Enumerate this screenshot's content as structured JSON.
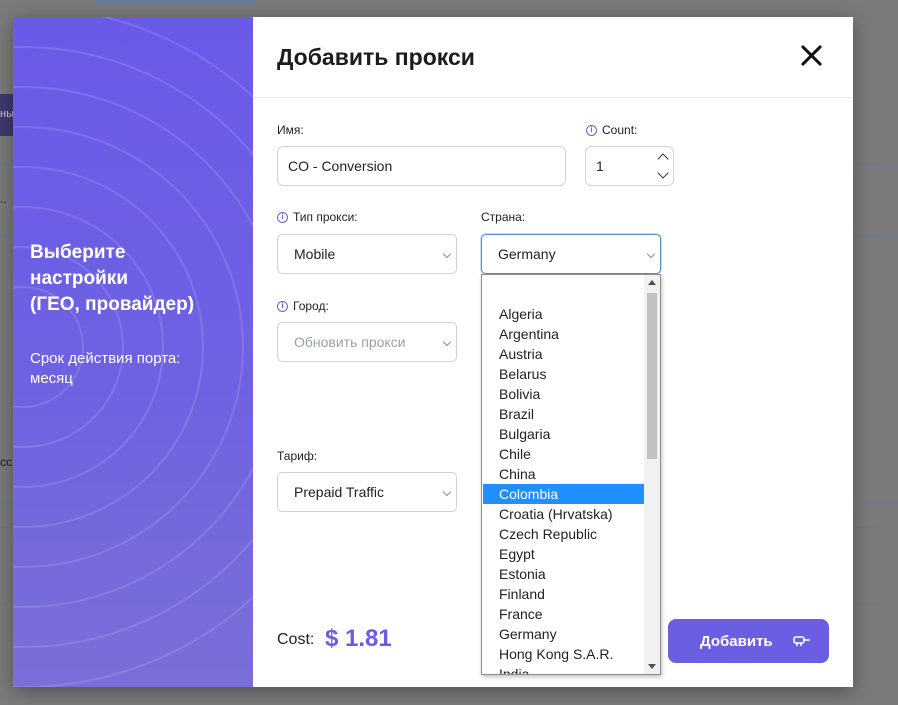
{
  "background": {
    "text_1": "ны",
    "text_2": "..",
    "text_3": "cc"
  },
  "sidebar": {
    "title": "Выберите\nнастройки\n(ГЕО, провайдер)",
    "subtitle": "Срок действия порта:\nмесяц",
    "accent": "#6a5ae8"
  },
  "modal": {
    "title": "Добавить прокси",
    "close_icon": "close-icon"
  },
  "form": {
    "name_label": "Имя:",
    "name_value": "CO - Conversion",
    "count_label": "Count:",
    "count_value": "1",
    "proxy_type_label": "Тип прокси:",
    "proxy_type_value": "Mobile",
    "country_label": "Страна:",
    "country_value": "Germany",
    "city_label": "Город:",
    "city_placeholder": "Обновить прокси",
    "tariff_label": "Тариф:",
    "tariff_value": "Prepaid Traffic"
  },
  "footer": {
    "cost_label": "Cost:",
    "cost_value": "$ 1.81",
    "add_label": "Добавить"
  },
  "country_options": {
    "selected": "Colombia",
    "items": [
      "",
      "Algeria",
      "Argentina",
      "Austria",
      "Belarus",
      "Bolivia",
      "Brazil",
      "Bulgaria",
      "Chile",
      "China",
      "Colombia",
      "Croatia (Hrvatska)",
      "Czech Republic",
      "Egypt",
      "Estonia",
      "Finland",
      "France",
      "Germany",
      "Hong Kong S.A.R.",
      "India"
    ]
  },
  "colors": {
    "primary": "#6c5ee2",
    "highlight": "#1e90ff"
  }
}
